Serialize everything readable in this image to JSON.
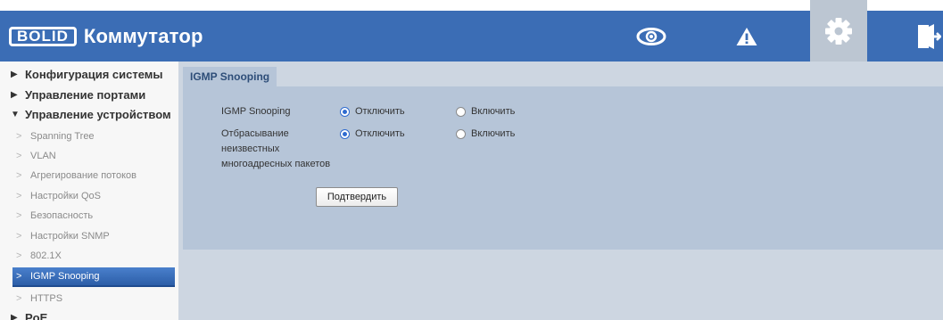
{
  "header": {
    "logo_text": "BOLID",
    "title": "Коммутатор",
    "icons": [
      "eye-icon",
      "alert-icon",
      "gear-icon",
      "exit-icon"
    ],
    "accent_color": "#3b6db5"
  },
  "sidebar": {
    "sections": [
      {
        "label": "Конфигурация системы",
        "expanded": false
      },
      {
        "label": "Управление портами",
        "expanded": false
      },
      {
        "label": "Управление устройством",
        "expanded": true
      },
      {
        "label": "PoE",
        "expanded": false
      }
    ],
    "items": [
      {
        "label": "Spanning Tree"
      },
      {
        "label": "VLAN"
      },
      {
        "label": "Агрегирование потоков"
      },
      {
        "label": "Настройки QoS"
      },
      {
        "label": "Безопасность"
      },
      {
        "label": "Настройки SNMP"
      },
      {
        "label": "802.1X"
      },
      {
        "label": "IGMP Snooping",
        "active": true
      },
      {
        "label": "HTTPS"
      }
    ]
  },
  "main": {
    "tab": "IGMP Snooping",
    "form": {
      "rows": [
        {
          "label_lines": [
            "IGMP Snooping"
          ],
          "options": [
            {
              "label": "Отключить",
              "selected": true
            },
            {
              "label": "Включить",
              "selected": false
            }
          ]
        },
        {
          "label_lines": [
            "Отбрасывание",
            "неизвестных",
            "многоадресных пакетов"
          ],
          "options": [
            {
              "label": "Отключить",
              "selected": true
            },
            {
              "label": "Включить",
              "selected": false
            }
          ]
        }
      ],
      "confirm_label": "Подтвердить"
    }
  }
}
